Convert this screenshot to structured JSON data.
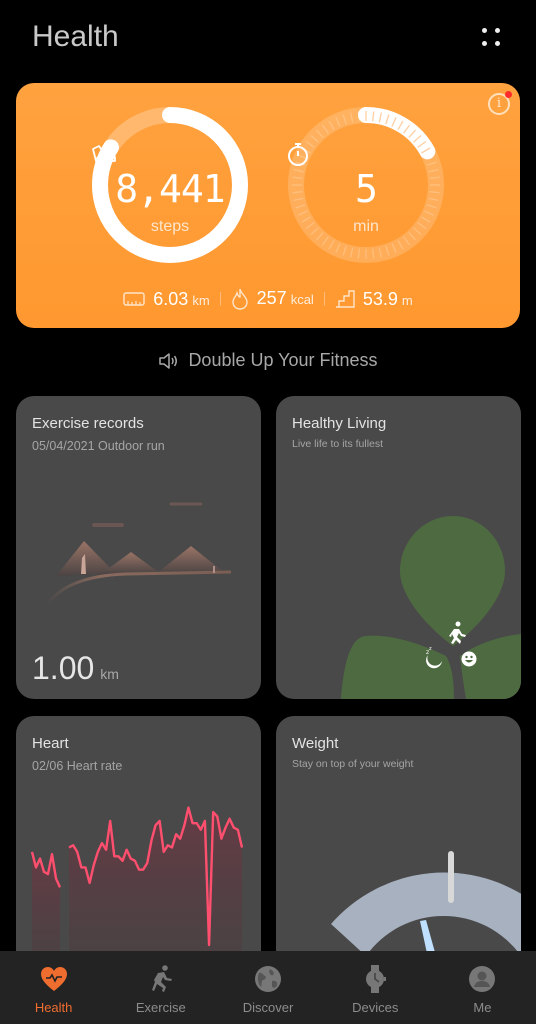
{
  "header": {
    "title": "Health",
    "more_icon": "four-dots-menu-icon"
  },
  "summary": {
    "steps": {
      "value": "8,441",
      "unit": "steps",
      "icon": "sneaker-icon",
      "goal_progress": 0.84
    },
    "active_minutes": {
      "value": "5",
      "unit": "min",
      "icon": "stopwatch-icon",
      "goal_progress": 0.17
    },
    "stats": [
      {
        "icon": "ruler-icon",
        "value": "6.03",
        "unit": "km"
      },
      {
        "icon": "flame-icon",
        "value": "257",
        "unit": "kcal"
      },
      {
        "icon": "stairs-icon",
        "value": "53.9",
        "unit": "m"
      }
    ],
    "info_icon": "info-icon",
    "has_notification": true,
    "colors": {
      "card_top": "#ffa23f",
      "card_bottom": "#ff982f",
      "notification": "#ff2b2b"
    }
  },
  "promo": {
    "icon": "speaker-icon",
    "text": "Double Up Your Fitness"
  },
  "cards": {
    "exercise": {
      "title": "Exercise records",
      "subtitle": "05/04/2021  Outdoor run",
      "distance": "1.00",
      "unit": "km"
    },
    "healthy": {
      "title": "Healthy Living",
      "subtitle": "Live life to its fullest",
      "leaf_color": "#4e6a41",
      "icons": [
        "running-icon",
        "sleep-moon-icon",
        "smile-icon"
      ]
    },
    "heart": {
      "title": "Heart",
      "subtitle": "02/06  Heart rate",
      "line_color": "#ff4f6e",
      "chart_data": {
        "type": "area",
        "series": [
          {
            "name": "segment-1",
            "values": [
              62,
              55,
              59,
              53,
              52,
              61,
              50,
              46
            ]
          },
          {
            "name": "segment-2",
            "values": [
              64,
              65,
              62,
              55,
              55,
              48,
              56,
              62,
              66,
              63,
              76,
              60,
              60,
              58,
              63,
              59,
              58,
              54,
              54,
              57,
              67,
              74,
              76,
              62,
              65,
              64,
              70,
              68,
              74,
              82,
              75,
              75,
              72,
              76,
              20,
              80,
              78,
              68,
              73,
              77,
              73,
              72,
              64
            ]
          }
        ]
      }
    },
    "weight": {
      "title": "Weight",
      "subtitle": "Stay on top of your weight",
      "gauge_color": "#a7b1bf",
      "needle_color": "#bfe0ff"
    }
  },
  "tabbar": {
    "items": [
      {
        "label": "Health",
        "icon": "heart-pulse-icon",
        "active": true
      },
      {
        "label": "Exercise",
        "icon": "running-icon",
        "active": false
      },
      {
        "label": "Discover",
        "icon": "globe-icon",
        "active": false
      },
      {
        "label": "Devices",
        "icon": "watch-icon",
        "active": false
      },
      {
        "label": "Me",
        "icon": "profile-icon",
        "active": false
      }
    ],
    "active_color": "#ee6d2f"
  }
}
